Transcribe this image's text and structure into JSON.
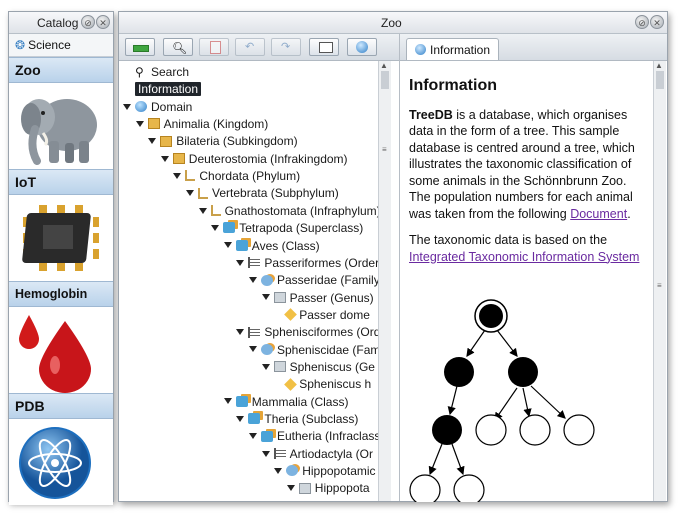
{
  "catalog": {
    "title": "Catalog",
    "science_label": "Science",
    "items": [
      {
        "label": "Zoo",
        "image": "elephant"
      },
      {
        "label": "IoT",
        "image": "microchip"
      },
      {
        "label": "Hemoglobin",
        "image": "blood-drops"
      },
      {
        "label": "PDB",
        "image": "atom"
      }
    ]
  },
  "zoo_window": {
    "title": "Zoo",
    "toolbar_icons": [
      "add-icon",
      "search-icon",
      "page-icon",
      "back-icon",
      "forward-icon",
      "folder-icon",
      "info-icon"
    ]
  },
  "tree": [
    {
      "label": "Search",
      "icon": "search-icon",
      "depth": 0,
      "expanded": null
    },
    {
      "label": "Information",
      "icon": "info-icon",
      "depth": 0,
      "expanded": null,
      "selected": true
    },
    {
      "label": "Domain",
      "icon": "globe-icon",
      "depth": 0,
      "expanded": true
    },
    {
      "label": "Animalia (Kingdom)",
      "icon": "folder-icon",
      "depth": 1,
      "expanded": true
    },
    {
      "label": "Bilateria (Subkingdom)",
      "icon": "folder-icon",
      "depth": 2,
      "expanded": true
    },
    {
      "label": "Deuterostomia (Infrakingdom)",
      "icon": "folder-icon",
      "depth": 3,
      "expanded": true
    },
    {
      "label": "Chordata (Phylum)",
      "icon": "phylum-icon",
      "depth": 4,
      "expanded": true
    },
    {
      "label": "Vertebrata (Subphylum)",
      "icon": "phylum-icon",
      "depth": 5,
      "expanded": true
    },
    {
      "label": "Gnathostomata (Infraphylum)",
      "icon": "phylum-icon",
      "depth": 6,
      "expanded": true
    },
    {
      "label": "Tetrapoda (Superclass)",
      "icon": "class-icon",
      "depth": 7,
      "expanded": true
    },
    {
      "label": "Aves (Class)",
      "icon": "class-icon",
      "depth": 8,
      "expanded": true
    },
    {
      "label": "Passeriformes (Order",
      "icon": "order-icon",
      "depth": 9,
      "expanded": true
    },
    {
      "label": "Passeridae (Family",
      "icon": "family-icon",
      "depth": 10,
      "expanded": true
    },
    {
      "label": "Passer (Genus)",
      "icon": "genus-icon",
      "depth": 11,
      "expanded": true
    },
    {
      "label": "Passer dome",
      "icon": "species-icon",
      "depth": 12,
      "expanded": null
    },
    {
      "label": "Sphenisciformes (Ord",
      "icon": "order-icon",
      "depth": 9,
      "expanded": true
    },
    {
      "label": "Spheniscidae (Fam",
      "icon": "family-icon",
      "depth": 10,
      "expanded": true
    },
    {
      "label": "Spheniscus (Ge",
      "icon": "genus-icon",
      "depth": 11,
      "expanded": true
    },
    {
      "label": "Spheniscus h",
      "icon": "species-icon",
      "depth": 12,
      "expanded": null
    },
    {
      "label": "Mammalia (Class)",
      "icon": "class-icon",
      "depth": 8,
      "expanded": true
    },
    {
      "label": "Theria (Subclass)",
      "icon": "class-icon",
      "depth": 9,
      "expanded": true
    },
    {
      "label": "Eutheria (Infraclass",
      "icon": "class-icon",
      "depth": 10,
      "expanded": true
    },
    {
      "label": "Artiodactyla (Or",
      "icon": "order-icon",
      "depth": 11,
      "expanded": true
    },
    {
      "label": "Hippopotamic",
      "icon": "family-icon",
      "depth": 12,
      "expanded": true
    },
    {
      "label": "Hippopota",
      "icon": "genus-icon",
      "depth": 13,
      "expanded": true
    }
  ],
  "info_pane": {
    "tab_label": "Information",
    "heading": "Information",
    "p1_bold": "TreeDB",
    "p1_text": " is a database, which organises data in the form of a tree. This sample database is centred around a tree, which illustrates the taxonomic classification of some animals in the Schönnbrunn Zoo. The population numbers for each animal was taken from the following ",
    "p1_link": "Document",
    "p1_end": ".",
    "p2_text": "The taxonomic data is based on the ",
    "p2_link": "Integrated Taxonomic Information System"
  },
  "colors": {
    "selection_bg": "#20252b",
    "link": "#6a2aa0",
    "catalog_label_bg": "#c7dcf0"
  }
}
